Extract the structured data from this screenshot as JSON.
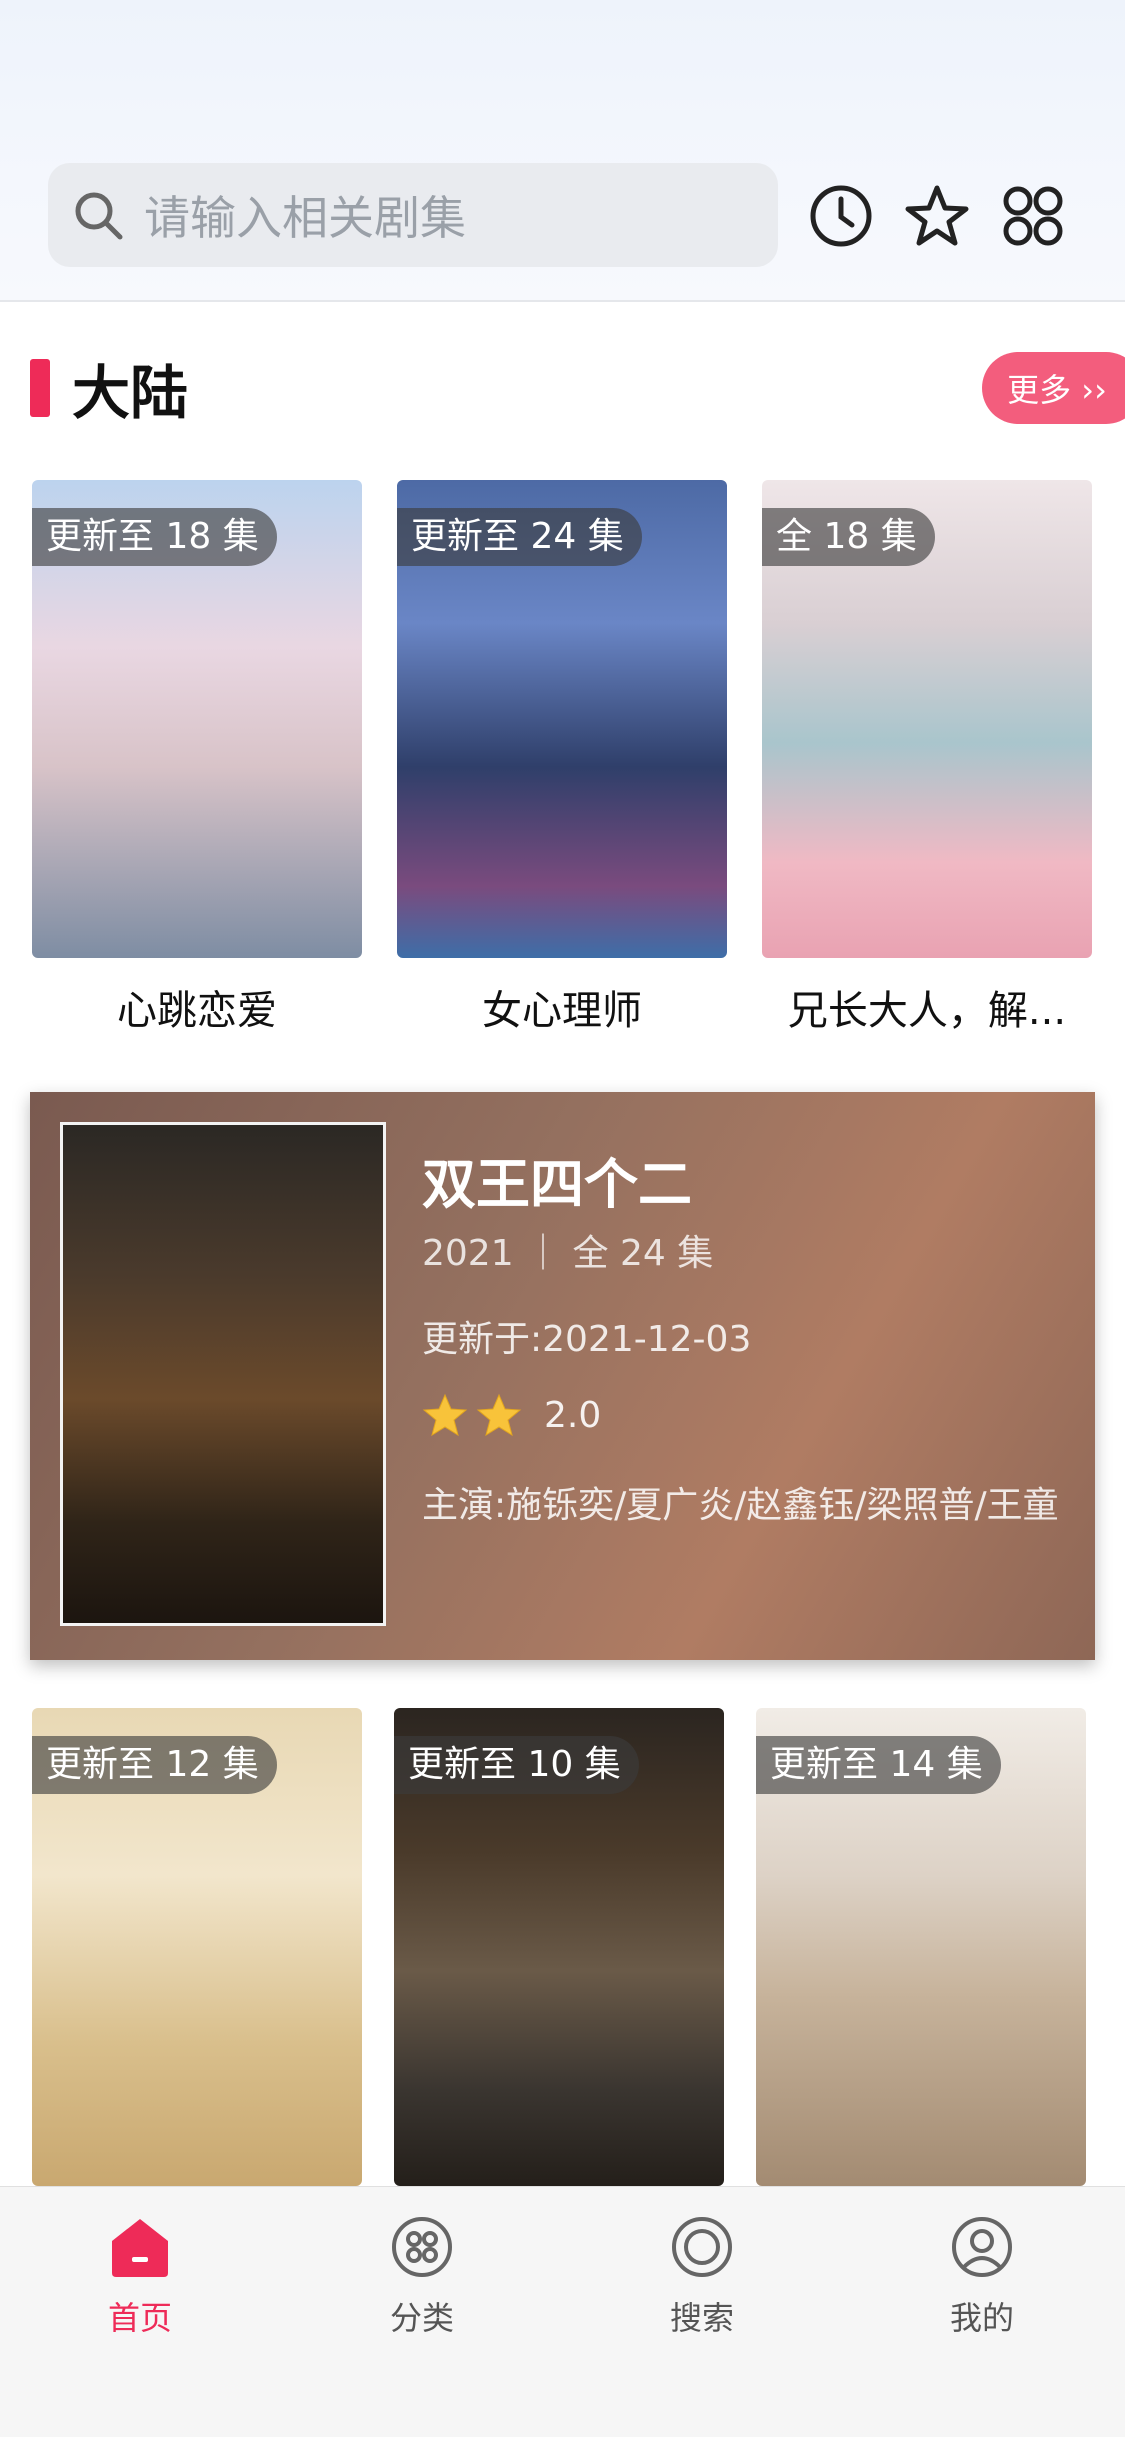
{
  "search": {
    "placeholder": "请输入相关剧集"
  },
  "section": {
    "title": "大陆",
    "more_label": "更多 ››"
  },
  "row1": [
    {
      "tag": "更新至 18 集",
      "title": "心跳恋爱"
    },
    {
      "tag": "更新至 24 集",
      "title": "女心理师"
    },
    {
      "tag": "全 18 集",
      "title": "兄长大人，解..."
    }
  ],
  "feature": {
    "title": "双王四个二",
    "meta": "2021 ｜ 全 24 集",
    "updated": "更新于:2021-12-03",
    "stars": 2,
    "score": "2.0",
    "cast": "主演:施铄奕/夏广炎/赵鑫钰/梁照普/王童"
  },
  "row2": [
    {
      "tag": "更新至 12 集"
    },
    {
      "tag": "更新至 10 集"
    },
    {
      "tag": "更新至 14 集"
    }
  ],
  "nav": [
    {
      "label": "首页",
      "icon": "home-icon",
      "active": true
    },
    {
      "label": "分类",
      "icon": "category-icon",
      "active": false
    },
    {
      "label": "搜索",
      "icon": "search-circle-icon",
      "active": false
    },
    {
      "label": "我的",
      "icon": "profile-icon",
      "active": false
    }
  ],
  "colors": {
    "accent": "#ee2b58",
    "more_button": "#f35d7d"
  }
}
